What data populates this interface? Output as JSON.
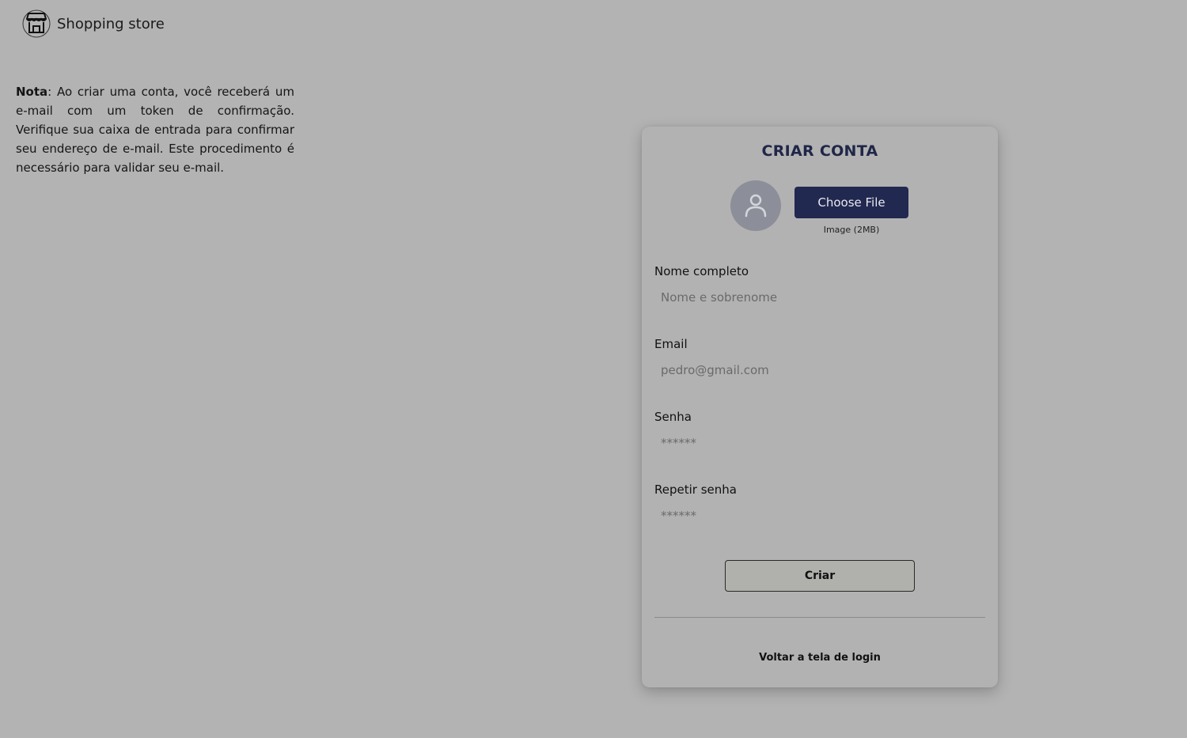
{
  "header": {
    "brand": "Shopping store",
    "logo_icon": "store-icon"
  },
  "note": {
    "label": "Nota",
    "text": ": Ao criar uma conta, você receberá um e-mail com um token de confirmação. Verifique sua caixa de entrada para confirmar seu endereço de e-mail. Este procedimento é necessário para validar seu e-mail."
  },
  "form": {
    "title": "CRIAR CONTA",
    "avatar_icon": "user-icon",
    "file_button": "Choose File",
    "file_hint": "Image (2MB)",
    "fields": {
      "name": {
        "label": "Nome completo",
        "placeholder": "Nome e sobrenome"
      },
      "email": {
        "label": "Email",
        "placeholder": "pedro@gmail.com"
      },
      "password": {
        "label": "Senha",
        "placeholder": "******"
      },
      "confirm": {
        "label": "Repetir senha",
        "placeholder": "******"
      }
    },
    "submit": "Criar",
    "back_link": "Voltar a tela de login"
  },
  "colors": {
    "background": "#b3b3b3",
    "accent": "#212950",
    "title": "#1f2648"
  }
}
